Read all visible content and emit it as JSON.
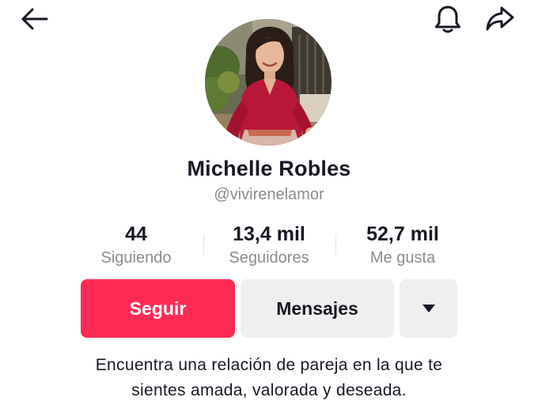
{
  "header": {
    "back_icon": "arrow-left-icon",
    "notification_icon": "bell-icon",
    "share_icon": "share-arrow-icon"
  },
  "profile": {
    "name": "Michelle Robles",
    "handle": "@vivirenelamor",
    "avatar_alt": "profile-photo"
  },
  "stats": [
    {
      "value": "44",
      "label": "Siguiendo"
    },
    {
      "value": "13,4 mil",
      "label": "Seguidores"
    },
    {
      "value": "52,7 mil",
      "label": "Me gusta"
    }
  ],
  "actions": {
    "follow_label": "Seguir",
    "message_label": "Mensajes",
    "more_icon": "caret-down-icon"
  },
  "bio": {
    "line1": "Encuentra una relación de pareja en la que te",
    "line2": "sientes amada, valorada y deseada."
  },
  "colors": {
    "accent": "#fe2c55",
    "secondary_button": "#efefef",
    "muted_text": "#8a8b91"
  }
}
